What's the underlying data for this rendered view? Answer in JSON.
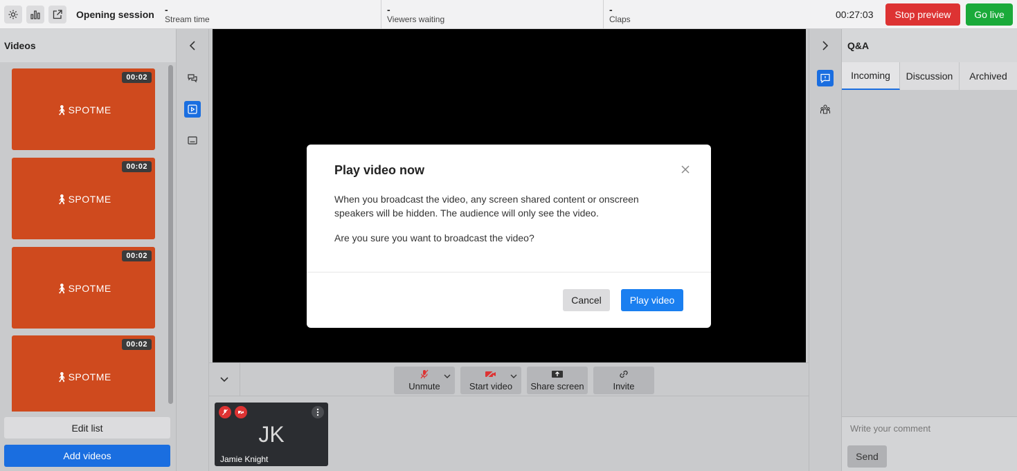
{
  "topbar": {
    "session_title": "Opening session",
    "stats": [
      {
        "value": "-",
        "label": "Stream time"
      },
      {
        "value": "-",
        "label": "Viewers waiting"
      },
      {
        "value": "-",
        "label": "Claps"
      }
    ],
    "timer": "00:27:03",
    "stop_preview_label": "Stop preview",
    "go_live_label": "Go live",
    "icons": [
      "gear-icon",
      "bar-chart-icon",
      "external-link-icon"
    ]
  },
  "videos": {
    "title": "Videos",
    "items": [
      {
        "duration": "00:02",
        "logo": "SPOTME"
      },
      {
        "duration": "00:02",
        "logo": "SPOTME"
      },
      {
        "duration": "00:02",
        "logo": "SPOTME"
      },
      {
        "duration": "00:02",
        "logo": "SPOTME"
      }
    ],
    "edit_label": "Edit list",
    "add_label": "Add videos"
  },
  "controls": {
    "unmute_label": "Unmute",
    "start_video_label": "Start video",
    "share_screen_label": "Share screen",
    "invite_label": "Invite"
  },
  "speaker": {
    "initials": "JK",
    "name": "Jamie Knight"
  },
  "qa": {
    "title": "Q&A",
    "tabs": [
      {
        "label": "Incoming"
      },
      {
        "label": "Discussion"
      },
      {
        "label": "Archived"
      }
    ],
    "comment_placeholder": "Write your comment",
    "send_label": "Send"
  },
  "modal": {
    "title": "Play video now",
    "paragraph1": "When you broadcast the video, any screen shared content or onscreen speakers will be hidden. The audience will only see the video.",
    "paragraph2": "Are you sure you want to broadcast the video?",
    "cancel_label": "Cancel",
    "play_label": "Play video"
  },
  "colors": {
    "accent": "#1a6ee0",
    "stop": "#dd3333",
    "live": "#1aaa3a",
    "thumbnail": "#cf4a1e"
  }
}
